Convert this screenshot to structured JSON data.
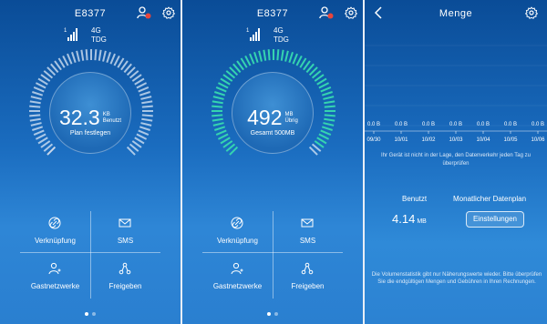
{
  "device_name": "E8377",
  "network": {
    "tech": "4G",
    "mode": "TDG",
    "signal_prefix": "1"
  },
  "screens": [
    {
      "value": "32.3",
      "unit": "KB",
      "unit_sub": "Benutzt",
      "caption": "Plan festlegen",
      "progress_fraction": 0.0,
      "ring_color": "#c9d7ea"
    },
    {
      "value": "492",
      "unit": "MB",
      "unit_sub": "Übrig",
      "caption": "Gesamt 500MB",
      "progress_fraction": 0.98,
      "ring_color": "#35d4b0"
    }
  ],
  "tiles": {
    "connection": "Verknüpfung",
    "sms": "SMS",
    "guest": "Gastnetzwerke",
    "share": "Freigeben"
  },
  "icons": [
    "user-alert-icon",
    "gear-icon",
    "link-icon",
    "envelope-icon",
    "add-user-icon",
    "share-icon",
    "back-icon"
  ],
  "detail": {
    "title": "Menge",
    "chart_data": {
      "type": "bar",
      "categories": [
        "09/30",
        "10/01",
        "10/02",
        "10/03",
        "10/04",
        "10/05",
        "10/06",
        "10"
      ],
      "values": [
        0,
        0,
        0,
        0,
        0,
        0,
        0,
        0
      ],
      "value_labels": [
        "0.0 B",
        "0.0 B",
        "0.0 B",
        "0.0 B",
        "0.0 B",
        "0.0 B",
        "0.0 B",
        "0.0"
      ]
    },
    "info_text": "Ihr Gerät ist nicht in der Lage, den Datenverkehr jeden Tag zu überprüfen",
    "used_label": "Benutzt",
    "plan_label": "Monatlicher Datenplan",
    "used_value": "4.14",
    "used_unit": "MB",
    "settings_button": "Einstellungen",
    "note": "Die Volumenstatistik gibt nur Näherungswerte wieder. Bitte überprüfen Sie die endgültigen Mengen und Gebühren in Ihren Rechnungen."
  },
  "colors": {
    "accent_teal": "#35d4b0",
    "alert_red": "#e8453c",
    "bg_blue": "#1a6cbf"
  }
}
